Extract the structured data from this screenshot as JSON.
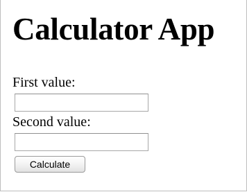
{
  "page": {
    "title": "Calculator App"
  },
  "form": {
    "first_label": "First value:",
    "first_value": "",
    "second_label": "Second value:",
    "second_value": "",
    "calculate_label": "Calculate"
  }
}
